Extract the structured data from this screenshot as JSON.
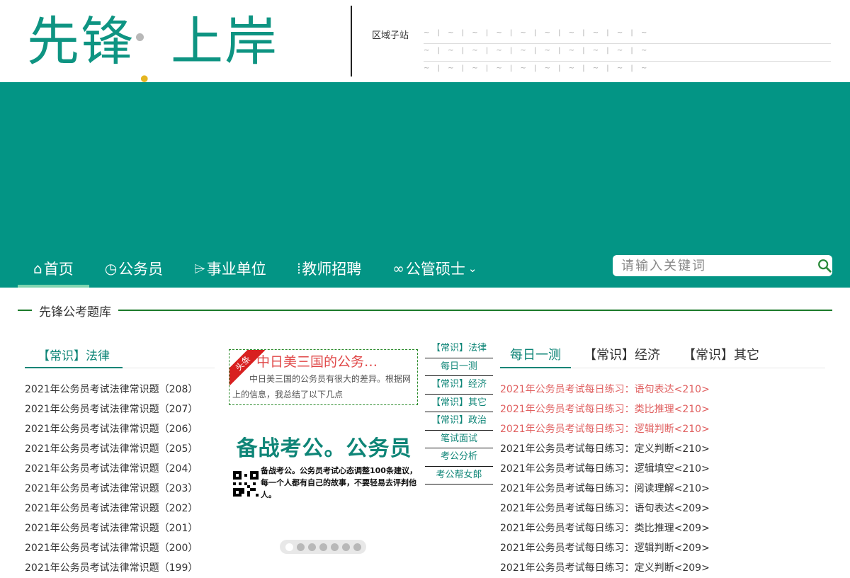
{
  "header": {
    "logo_part1": "先锋",
    "logo_dot": ".",
    "logo_part2": "上岸",
    "region_label": "区域子站",
    "region_rows": [
      "~ | ~ | ~ | ~ | ~ | ~ | ~ | ~ | ~ |  ~",
      "~ | ~ | ~ | ~ | ~ | ~ | ~ | ~ | ~ |  ~",
      "~ | ~ | ~ | ~ | ~ | ~ | ~ | ~ | ~ |  ~"
    ]
  },
  "nav": {
    "items": [
      {
        "label": "首页",
        "icon": "⌂"
      },
      {
        "label": "公务员",
        "icon": "◷"
      },
      {
        "label": "事业单位",
        "icon": "⌲"
      },
      {
        "label": "教师招聘",
        "icon": "⦙"
      },
      {
        "label": "公管硕士",
        "icon": "∞",
        "caret": "⌄"
      }
    ],
    "search_placeholder": "请输入关键词"
  },
  "section": {
    "title": "先锋公考题库"
  },
  "left_panel": {
    "tab": "【常识】法律",
    "items": [
      "2021年公务员考试法律常识题（208）",
      "2021年公务员考试法律常识题（207）",
      "2021年公务员考试法律常识题（206）",
      "2021年公务员考试法律常识题（205）",
      "2021年公务员考试法律常识题（204）",
      "2021年公务员考试法律常识题（203）",
      "2021年公务员考试法律常识题（202）",
      "2021年公务员考试法律常识题（201）",
      "2021年公务员考试法律常识题（200）",
      "2021年公务员考试法律常识题（199）"
    ]
  },
  "carousel": {
    "ribbon": "头条",
    "headline_title": "中日美三国的公务…",
    "headline_text": "中日美三国的公务员有很大的差异。根据网上的信息，我总结了以下几点",
    "ad_title": "备战考公。公务员",
    "ad_text": "备战考公。公务员考试心态调整100条建议，每一个人都有自己的故事，不要轻易去评判他人。",
    "slide_count": 7,
    "active_slide": 1
  },
  "side_menu": {
    "items": [
      "【常识】法律",
      "每日一测",
      "【常识】经济",
      "【常识】其它",
      "【常识】政治",
      "笔试面试",
      "考公分析",
      "考公帮女郎"
    ]
  },
  "right_panel": {
    "tabs": [
      "每日一测",
      "【常识】经济",
      "【常识】其它"
    ],
    "items": [
      {
        "text": "2021年公务员考试每日练习：语句表达<210>",
        "hot": true
      },
      {
        "text": "2021年公务员考试每日练习：类比推理<210>",
        "hot": true
      },
      {
        "text": "2021年公务员考试每日练习：逻辑判断<210>",
        "hot": true
      },
      {
        "text": "2021年公务员考试每日练习：定义判断<210>",
        "hot": false
      },
      {
        "text": "2021年公务员考试每日练习：逻辑填空<210>",
        "hot": false
      },
      {
        "text": "2021年公务员考试每日练习：阅读理解<210>",
        "hot": false
      },
      {
        "text": "2021年公务员考试每日练习：语句表达<209>",
        "hot": false
      },
      {
        "text": "2021年公务员考试每日练习：类比推理<209>",
        "hot": false
      },
      {
        "text": "2021年公务员考试每日练习：逻辑判断<209>",
        "hot": false
      },
      {
        "text": "2021年公务员考试每日练习：定义判断<209>",
        "hot": false
      }
    ]
  },
  "colors": {
    "brand": "#039585",
    "accent": "#e5b520",
    "hot": "#e06060"
  }
}
